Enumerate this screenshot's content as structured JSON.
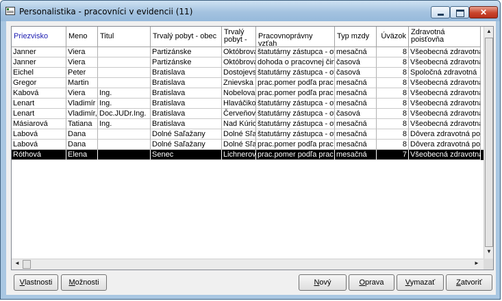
{
  "window": {
    "title": "Personalistika - pracovníci v evidencii (11)",
    "close_glyph": "✕"
  },
  "columns": [
    {
      "label": "Priezvisko",
      "sorted": true
    },
    {
      "label": "Meno"
    },
    {
      "label": "Titul"
    },
    {
      "label": "Trvalý pobyt - obec"
    },
    {
      "label": "Trvalý pobyt -"
    },
    {
      "label": "Pracovnoprávny vzťah"
    },
    {
      "label": "Typ mzdy"
    },
    {
      "label": "Úväzok"
    },
    {
      "label": "Zdravotná poisťovňa"
    }
  ],
  "rows": [
    [
      "Janner",
      "Viera",
      "",
      "Partizánske",
      "Októbrová",
      "štatutárny zástupca - ot",
      "mesačná",
      "8",
      "Všeobecná zdravotná"
    ],
    [
      "Janner",
      "Viera",
      "",
      "Partizánske",
      "Októbrová",
      "dohoda o pracovnej čin",
      "časová",
      "8",
      "Všeobecná zdravotná"
    ],
    [
      "Eichel",
      "Peter",
      "",
      "Bratislava",
      "Dostojevs",
      "štatutárny zástupca - ot",
      "časová",
      "8",
      "Spoločná zdravotná"
    ],
    [
      "Gregor",
      "Martin",
      "",
      "Bratislava",
      "Znievska",
      "prac.pomer podľa prac",
      "mesačná",
      "8",
      "Všeobecná zdravotná"
    ],
    [
      "Kabová",
      "Viera",
      "Ing.",
      "Bratislava",
      "Nobelova",
      "prac.pomer podľa prac",
      "mesačná",
      "8",
      "Všeobecná zdravotná"
    ],
    [
      "Lenart",
      "Vladimír",
      "Ing.",
      "Bratislava",
      "Hlaváčiko",
      "štatutárny zástupca - ot",
      "mesačná",
      "8",
      "Všeobecná zdravotná"
    ],
    [
      "Lenart",
      "Vladimír,",
      "Doc.JUDr.Ing.",
      "Bratislava",
      "Červeňov",
      "štatutárny zástupca - ot",
      "časová",
      "8",
      "Všeobecná zdravotná"
    ],
    [
      "Másiarová",
      "Tatiana",
      "Ing.",
      "Bratislava",
      "Nad Kúric",
      "štatutárny zástupca - ot",
      "mesačná",
      "8",
      "Všeobecná zdravotná"
    ],
    [
      "Labová",
      "Dana",
      "",
      "Dolné Saľažany",
      "Dolné Sľa",
      "štatutárny zástupca - ot",
      "mesačná",
      "8",
      "Dôvera zdravotná po"
    ],
    [
      "Labová",
      "Dana",
      "",
      "Dolné Saľažany",
      "Dolné Sľa",
      "prac.pomer podľa prac",
      "mesačná",
      "8",
      "Dôvera zdravotná po"
    ],
    [
      "Róthová",
      "Elena",
      "",
      "Senec",
      "Lichnerov",
      "prac.pomer podľa prac",
      "mesačná",
      "7",
      "Všeobecná zdravotná"
    ]
  ],
  "selected_row": 10,
  "scroll": {
    "up": "▲",
    "down": "▼",
    "left": "◄",
    "right": "►"
  },
  "buttons": {
    "vlastnosti": {
      "pre": "V",
      "rest": "lastnosti"
    },
    "moznosti": {
      "pre": "M",
      "rest": "ožnosti"
    },
    "novy": {
      "pre": "N",
      "rest": "ový"
    },
    "oprava": {
      "pre": "O",
      "rest": "prava"
    },
    "vymazat": {
      "pre": "V",
      "rest": "ymazať"
    },
    "zatvorit": {
      "pre": "Z",
      "rest": "atvoriť"
    }
  }
}
